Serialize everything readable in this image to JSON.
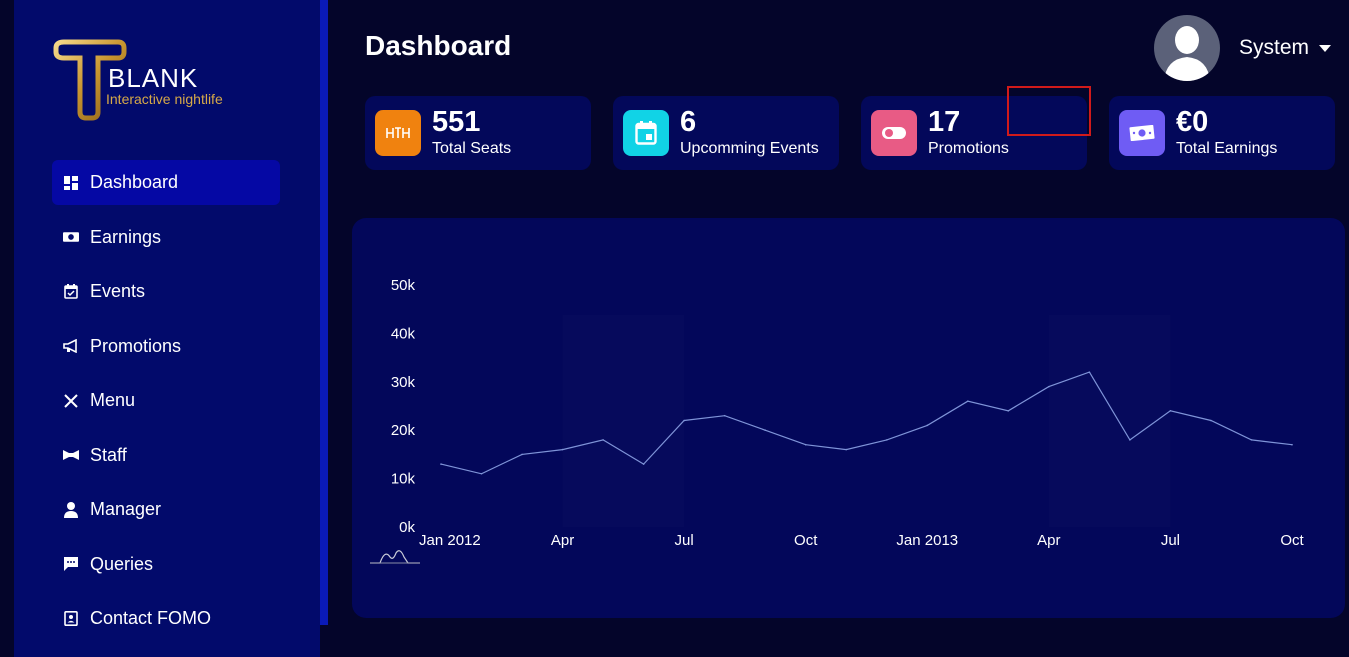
{
  "brand": {
    "name": "BLANK",
    "tagline": "Interactive nightlife"
  },
  "page": {
    "title": "Dashboard"
  },
  "user": {
    "name": "System"
  },
  "sidebar": {
    "items": [
      {
        "label": "Dashboard",
        "icon": "dashboard-icon",
        "active": true
      },
      {
        "label": "Earnings",
        "icon": "money-icon"
      },
      {
        "label": "Events",
        "icon": "calendar-icon"
      },
      {
        "label": "Promotions",
        "icon": "megaphone-icon"
      },
      {
        "label": "Menu",
        "icon": "utensils-icon"
      },
      {
        "label": "Staff",
        "icon": "bowtie-icon"
      },
      {
        "label": "Manager",
        "icon": "user-tie-icon"
      },
      {
        "label": "Queries",
        "icon": "chat-icon"
      },
      {
        "label": "Contact FOMO",
        "icon": "contact-icon"
      }
    ]
  },
  "stats": [
    {
      "value": "551",
      "label": "Total Seats",
      "icon": "seats-icon",
      "color": "#f0820f"
    },
    {
      "value": "6",
      "label": "Upcomming Events",
      "icon": "calendar-icon",
      "color": "#11d3e6"
    },
    {
      "value": "17",
      "label": "Promotions",
      "icon": "toggle-icon",
      "color": "#e85b85"
    },
    {
      "value": "€0",
      "label": "Total Earnings",
      "icon": "money-icon",
      "color": "#6f5cf4"
    }
  ],
  "colors": {
    "accent": "#0508a4",
    "line": "#7f94d8"
  },
  "chart_data": {
    "type": "line",
    "title": "",
    "xlabel": "",
    "ylabel": "",
    "x": [
      "2012-01",
      "2012-02",
      "2012-03",
      "2012-04",
      "2012-05",
      "2012-06",
      "2012-07",
      "2012-08",
      "2012-09",
      "2012-10",
      "2012-11",
      "2012-12",
      "2013-01",
      "2013-02",
      "2013-03",
      "2013-04",
      "2013-05",
      "2013-06",
      "2013-07",
      "2013-08",
      "2013-09",
      "2013-10"
    ],
    "series": [
      {
        "values": [
          13000,
          11000,
          15000,
          16000,
          18000,
          13000,
          22000,
          23000,
          20000,
          17000,
          16000,
          18000,
          21000,
          26000,
          24000,
          29000,
          32000,
          18000,
          24000,
          22000,
          18000,
          17000
        ]
      }
    ],
    "ylim": [
      0,
      50000
    ],
    "y_ticks": [
      "0k",
      "10k",
      "20k",
      "30k",
      "40k",
      "50k"
    ],
    "x_tick_labels": [
      "Jan 2012",
      "Apr",
      "Jul",
      "Oct",
      "Jan 2013",
      "Apr",
      "Jul",
      "Oct"
    ],
    "grid": false,
    "legend": "none"
  }
}
